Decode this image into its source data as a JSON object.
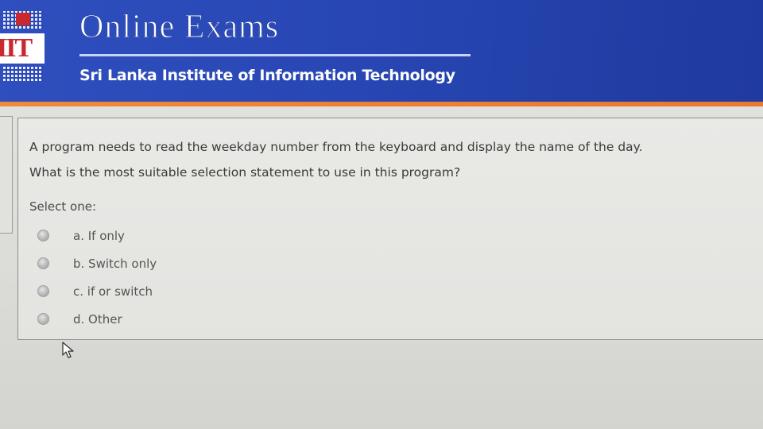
{
  "header": {
    "title": "Online Exams",
    "subtitle": "Sri Lanka Institute of Information Technology",
    "logo_text": "IIT",
    "colors": {
      "banner": "#2a48b6",
      "accent_strip": "#ee7f35",
      "logo_red": "#c8282e"
    }
  },
  "question": {
    "lines": [
      "A program needs to read the weekday number from the keyboard and display the name of the day.",
      "What is the most suitable selection statement to use in this program?"
    ],
    "select_label": "Select one:",
    "options": [
      {
        "label": "a. If only",
        "selected": false
      },
      {
        "label": "b. Switch only",
        "selected": false
      },
      {
        "label": "c. if or switch",
        "selected": false
      },
      {
        "label": "d. Other",
        "selected": false
      }
    ]
  },
  "cursor": {
    "icon": "arrow-cursor-icon"
  }
}
